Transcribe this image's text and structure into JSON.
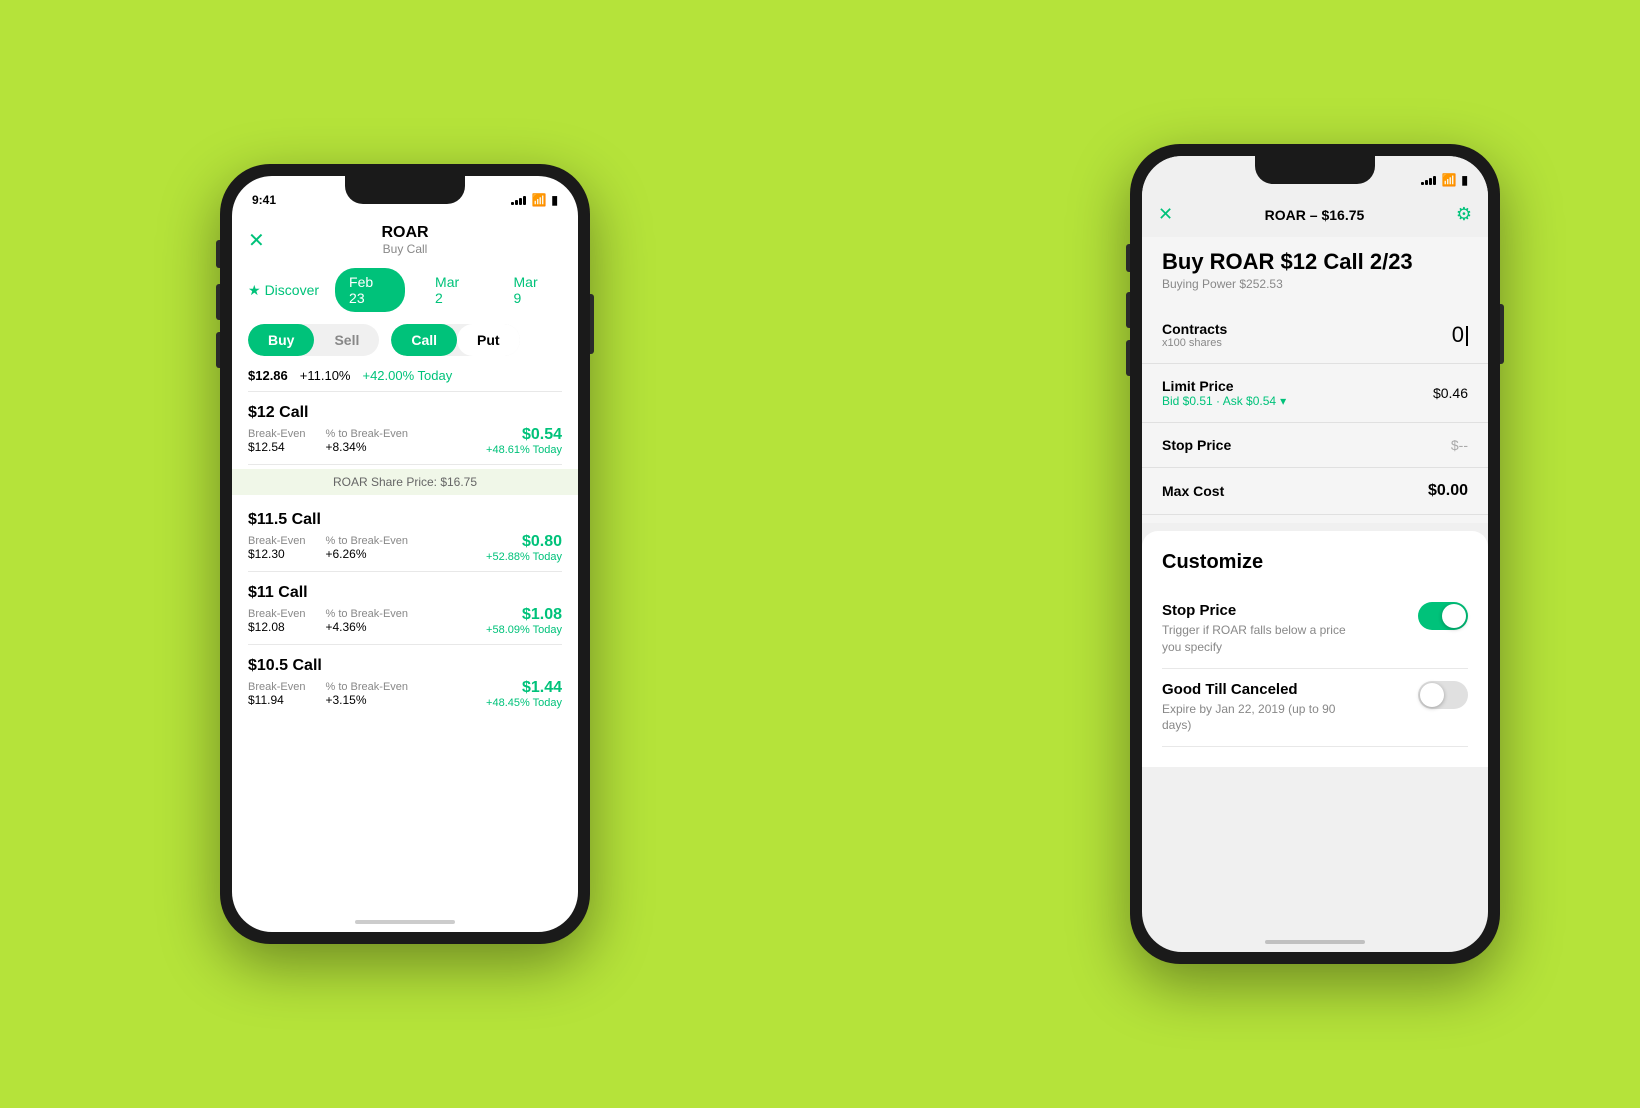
{
  "background": "#b5e33a",
  "phone_left": {
    "status": {
      "time": "9:41",
      "signal": [
        3,
        4,
        5,
        6
      ],
      "wifi": "wifi",
      "battery": "battery"
    },
    "header": {
      "close_icon": "✕",
      "ticker": "ROAR",
      "subtitle": "Buy Call"
    },
    "tabs": {
      "discover_icon": "★",
      "discover_label": "Discover",
      "dates": [
        "Feb 23",
        "Mar 2",
        "Mar 9"
      ],
      "active_date": "Feb 23"
    },
    "toggles": {
      "buy_label": "Buy",
      "sell_label": "Sell",
      "call_label": "Call",
      "put_label": "Put"
    },
    "price_row": {
      "price": "$12.86",
      "pct": "+11.10%",
      "today": "+42.00% Today"
    },
    "options": [
      {
        "name": "$12 Call",
        "breakeven_label": "Break-Even",
        "breakeven_val": "$12.54",
        "pct_label": "% to Break-Even",
        "pct_val": "+8.34%",
        "price": "$0.54",
        "today": "+48.61% Today"
      },
      {
        "banner": "ROAR Share Price: $16.75"
      },
      {
        "name": "$11.5 Call",
        "breakeven_label": "Break-Even",
        "breakeven_val": "$12.30",
        "pct_label": "% to Break-Even",
        "pct_val": "+6.26%",
        "price": "$0.80",
        "today": "+52.88% Today"
      },
      {
        "name": "$11 Call",
        "breakeven_label": "Break-Even",
        "breakeven_val": "$12.08",
        "pct_label": "% to Break-Even",
        "pct_val": "+4.36%",
        "price": "$1.08",
        "today": "+58.09% Today"
      },
      {
        "name": "$10.5 Call",
        "breakeven_label": "Break-Even",
        "breakeven_val": "$11.94",
        "pct_label": "% to Break-Even",
        "pct_val": "+3.15%",
        "price": "$1.44",
        "today": "+48.45% Today"
      }
    ]
  },
  "phone_right": {
    "status": {
      "time": "",
      "signal": []
    },
    "header": {
      "close_icon": "✕",
      "title": "ROAR – $16.75",
      "gear_icon": "⚙"
    },
    "buy_section": {
      "title": "Buy ROAR $12 Call 2/23",
      "buying_power_label": "Buying Power $252.53"
    },
    "form_rows": [
      {
        "label": "Contracts",
        "sublabel": "x100 shares",
        "value": "0",
        "type": "input"
      },
      {
        "label": "Limit Price",
        "bid_ask": "Bid $0.51 · Ask $0.54",
        "chevron": "▾",
        "value": "$0.46",
        "type": "price"
      },
      {
        "label": "Stop Price",
        "value": "$--",
        "type": "stop"
      },
      {
        "label": "Max Cost",
        "value": "$0.00",
        "type": "max"
      }
    ],
    "customize": {
      "title": "Customize",
      "items": [
        {
          "label": "Stop Price",
          "description": "Trigger if ROAR falls below a price you specify",
          "enabled": true
        },
        {
          "label": "Good Till Canceled",
          "description": "Expire by Jan 22, 2019 (up to 90 days)",
          "enabled": false
        }
      ]
    }
  }
}
